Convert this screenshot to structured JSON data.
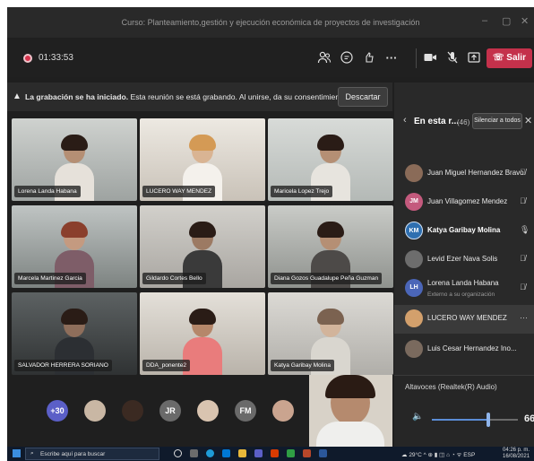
{
  "window": {
    "title": "Curso: Planteamiento,gestión y ejecución económica de proyectos de investigación",
    "controls": [
      "–",
      "▢",
      "✕"
    ]
  },
  "toolbar": {
    "timer": "01:33:53",
    "leave_label": "Salir",
    "leave_color": "#c4314b",
    "more_label": "···"
  },
  "banner": {
    "bold_text": "La grabación se ha iniciado.",
    "text": "Esta reunión se está grabando. Al unirse, da su consentimiento para que ...",
    "discard_label": "Descartar"
  },
  "tiles": [
    {
      "name": "Lorena Landa Habana"
    },
    {
      "name": "LUCERO WAY MENDEZ"
    },
    {
      "name": "Maricela Lopez Trejo"
    },
    {
      "name": "Marcela Martinez Garcia"
    },
    {
      "name": "Gildardo Cortes Bello"
    },
    {
      "name": "Diana Gozos Guadalupe Peña Guzman"
    },
    {
      "name": "SALVADOR HERRERA SORIANO"
    },
    {
      "name": "DDA_ponente2"
    },
    {
      "name": "Katya Garibay Molina"
    }
  ],
  "strip": {
    "overflow_count": "+30",
    "initials_1": "JR",
    "initials_2": "FM"
  },
  "panel": {
    "title": "En esta r...",
    "count": "(46)",
    "mute_all_label": "Silenciar a todos",
    "participants": [
      {
        "name": "Juan Miguel Hernandez Bravo",
        "initials": "",
        "sub": ""
      },
      {
        "name": "Juan Villagomez Mendez",
        "initials": "JM",
        "sub": ""
      },
      {
        "name": "Katya Garibay Molina",
        "initials": "KM",
        "sub": ""
      },
      {
        "name": "Levid Ezer Nava Solis",
        "initials": "",
        "sub": ""
      },
      {
        "name": "Lorena Landa Habana",
        "initials": "LH",
        "sub": "Externo a su organización"
      },
      {
        "name": "LUCERO WAY MENDEZ",
        "initials": "",
        "sub": "",
        "more": "···"
      },
      {
        "name": "Luis Cesar Hernandez Ino...",
        "initials": "",
        "sub": ""
      }
    ]
  },
  "audio": {
    "label": "Altavoces (Realtek(R) Audio)",
    "volume": "66",
    "volume_fraction": 0.66
  },
  "taskbar": {
    "search_placeholder": "Escribe aquí para buscar",
    "temperature": "29°C",
    "time": "04:26 p. m.",
    "date": "16/08/2021"
  }
}
